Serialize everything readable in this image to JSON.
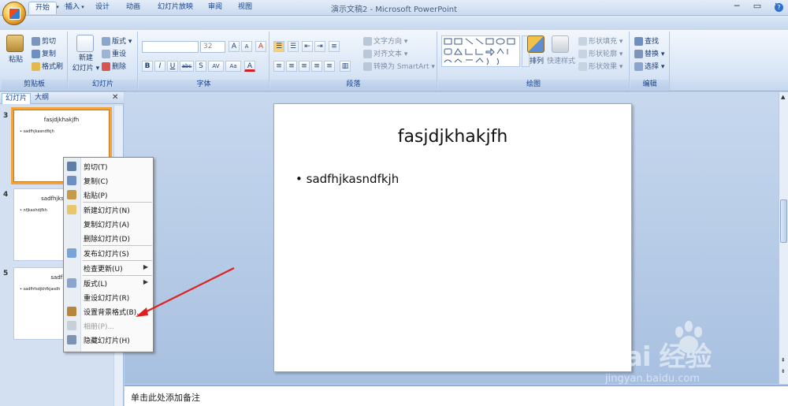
{
  "window": {
    "title": "演示文稿2 - Microsoft PowerPoint",
    "minimize": "─",
    "maximize": "▭",
    "close": "✕"
  },
  "quick_access": {
    "save_icon": "save-icon",
    "undo_glyph": "↶",
    "redo_glyph": "↷",
    "dropdown_glyph": "▾"
  },
  "tabs": [
    {
      "label": "开始",
      "active": true
    },
    {
      "label": "插入"
    },
    {
      "label": "设计"
    },
    {
      "label": "动画"
    },
    {
      "label": "幻灯片放映"
    },
    {
      "label": "审阅"
    },
    {
      "label": "视图"
    }
  ],
  "help_glyph": "?",
  "ribbon": {
    "clipboard": {
      "label": "剪贴板",
      "paste": "粘贴",
      "cut": "剪切",
      "copy": "复制",
      "format_painter": "格式刷"
    },
    "slides": {
      "label": "幻灯片",
      "new_slide_1": "新建",
      "new_slide_2": "幻灯片 ▾",
      "layout": "版式 ▾",
      "reset": "重设",
      "delete": "删除"
    },
    "font": {
      "label": "字体",
      "size": "32",
      "bold": "B",
      "italic": "I",
      "underline": "U",
      "strike": "abc",
      "shadow": "S",
      "spacing": "AV",
      "case": "Aa",
      "color": "A",
      "grow": "A",
      "shrink": "A",
      "clear": "A"
    },
    "paragraph": {
      "label": "段落",
      "text_direction": "文字方向 ▾",
      "align_text": "对齐文本 ▾",
      "smartart": "转换为 SmartArt ▾"
    },
    "drawing": {
      "label": "绘图",
      "arrange": "排列",
      "quick_styles": "快速样式",
      "shape_fill": "形状填充 ▾",
      "shape_outline": "形状轮廓 ▾",
      "shape_effects": "形状效果 ▾"
    },
    "editing": {
      "label": "编辑",
      "find": "查找",
      "replace": "替换 ▾",
      "select": "选择 ▾"
    }
  },
  "left_panel": {
    "tab_slides": "幻灯片",
    "tab_outline": "大纲",
    "close_glyph": "✕",
    "thumbs": [
      {
        "num": "3",
        "title": "fasjdjkhakjfh",
        "body": "• sadfhjkasndfkjh"
      },
      {
        "num": "4",
        "title": "sadfhjksajhfkjs",
        "body": "• nfjkashdjfkh"
      },
      {
        "num": "5",
        "title": "sadfhsa",
        "body": "• sadfhfsdjkhfkjasdh"
      }
    ]
  },
  "slide": {
    "title": "fasjdjkhakjfh",
    "bullet": "sadfhjkasndfkjh"
  },
  "notes_placeholder": "单击此处添加备注",
  "context_menu": [
    {
      "label": "剪切(T)",
      "icon": "scissors-icon",
      "color": "#5f7fa8"
    },
    {
      "label": "复制(C)",
      "icon": "copy-icon",
      "color": "#6d8fc2"
    },
    {
      "label": "粘贴(P)",
      "icon": "paste-icon",
      "color": "#c79a4a"
    },
    {
      "sep": true
    },
    {
      "label": "新建幻灯片(N)",
      "icon": "new-slide-icon",
      "color": "#e8c66a"
    },
    {
      "label": "复制幻灯片(A)",
      "icon": "",
      "color": ""
    },
    {
      "label": "删除幻灯片(D)",
      "icon": "",
      "color": ""
    },
    {
      "sep": true
    },
    {
      "label": "发布幻灯片(S)",
      "icon": "publish-icon",
      "color": "#7aa3d9"
    },
    {
      "sep": true
    },
    {
      "label": "检查更新(U)",
      "icon": "",
      "color": "",
      "submenu": true
    },
    {
      "sep": true
    },
    {
      "label": "版式(L)",
      "icon": "layout-icon",
      "color": "#8aa6cf",
      "submenu": true
    },
    {
      "label": "重设幻灯片(R)",
      "icon": "",
      "color": ""
    },
    {
      "label": "设置背景格式(B)...",
      "icon": "background-icon",
      "color": "#b8863a"
    },
    {
      "label": "相册(P)...",
      "icon": "album-icon",
      "color": "#c7cfd9",
      "disabled": true
    },
    {
      "label": "隐藏幻灯片(H)",
      "icon": "hide-slide-icon",
      "color": "#7d93b4"
    }
  ],
  "watermark": {
    "text": "Bai 经验",
    "url": "jingyan.baidu.com"
  },
  "colors": {
    "annotation_arrow": "#e02020",
    "selection_outline": "#f2a33a"
  }
}
